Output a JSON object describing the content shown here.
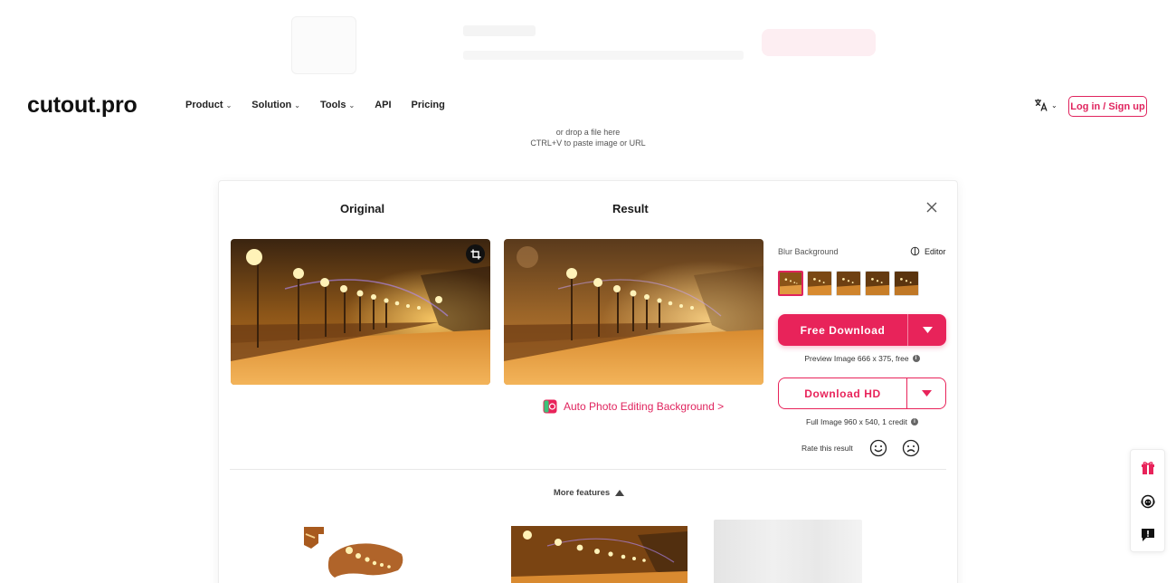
{
  "nav": {
    "logo": "cutout.pro",
    "menu": [
      {
        "label": "Product",
        "has_dropdown": true
      },
      {
        "label": "Solution",
        "has_dropdown": true
      },
      {
        "label": "Tools",
        "has_dropdown": true
      },
      {
        "label": "API",
        "has_dropdown": false
      },
      {
        "label": "Pricing",
        "has_dropdown": false
      }
    ],
    "language_icon": "translate-icon",
    "login_label": "Log in / Sign up"
  },
  "upload_hint": {
    "line1": "or drop a file here",
    "line2": "CTRL+V to paste image or URL"
  },
  "result_card": {
    "original_title": "Original",
    "result_title": "Result",
    "auto_link": "Auto Photo Editing Background >",
    "blur_label": "Blur Background",
    "editor_label": "Editor",
    "thumbnail_count": 5,
    "selected_thumbnail": 0,
    "free_download_label": "Free Download",
    "free_caption": "Preview Image 666 x 375, free",
    "hd_download_label": "Download HD",
    "hd_caption": "Full Image 960 x 540, 1 credit",
    "rate_label": "Rate this result",
    "more_features_label": "More features"
  },
  "colors": {
    "accent": "#e8235a",
    "link": "#e0245e"
  },
  "floating_toolbar": {
    "icons": [
      "gift-icon",
      "support-agent-icon",
      "feedback-icon"
    ]
  }
}
